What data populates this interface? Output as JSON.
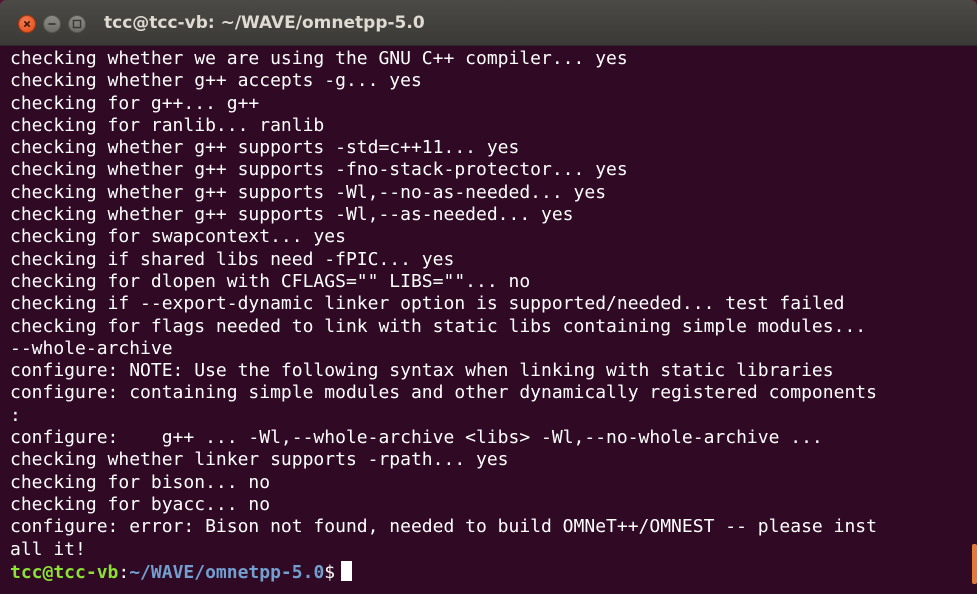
{
  "window": {
    "title": "tcc@tcc-vb: ~/WAVE/omnetpp-5.0",
    "buttons": {
      "close_icon": "close-icon",
      "minimize_icon": "minimize-icon",
      "maximize_icon": "maximize-icon"
    },
    "colors": {
      "terminal_bg": "#300a24",
      "prompt_user": "#8ae234",
      "prompt_path": "#729fcf",
      "close_button": "#df4b16"
    }
  },
  "terminal": {
    "lines": [
      "checking whether we are using the GNU C++ compiler... yes",
      "checking whether g++ accepts -g... yes",
      "checking for g++... g++",
      "checking for ranlib... ranlib",
      "checking whether g++ supports -std=c++11... yes",
      "checking whether g++ supports -fno-stack-protector... yes",
      "checking whether g++ supports -Wl,--no-as-needed... yes",
      "checking whether g++ supports -Wl,--as-needed... yes",
      "checking for swapcontext... yes",
      "checking if shared libs need -fPIC... yes",
      "checking for dlopen with CFLAGS=\"\" LIBS=\"\"... no",
      "checking if --export-dynamic linker option is supported/needed... test failed",
      "checking for flags needed to link with static libs containing simple modules...",
      "--whole-archive",
      "configure: NOTE: Use the following syntax when linking with static libraries",
      "configure: containing simple modules and other dynamically registered components",
      ":",
      "configure:    g++ ... -Wl,--whole-archive <libs> -Wl,--no-whole-archive ...",
      "checking whether linker supports -rpath... yes",
      "checking for bison... no",
      "checking for byacc... no",
      "configure: error: Bison not found, needed to build OMNeT++/OMNEST -- please inst",
      "all it!"
    ],
    "prompt": {
      "user_host": "tcc@tcc-vb",
      "separator": ":",
      "path": "~/WAVE/omnetpp-5.0",
      "symbol": "$"
    }
  }
}
